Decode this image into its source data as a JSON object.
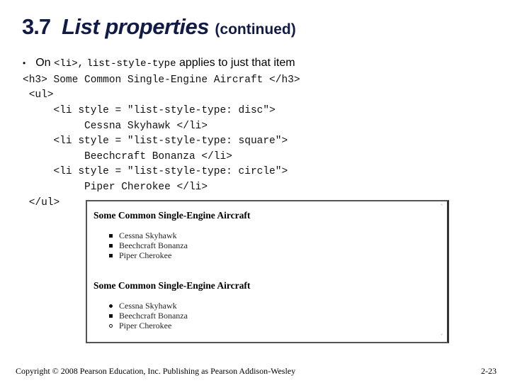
{
  "title": {
    "number": "3.7",
    "main": "List properties",
    "suffix": "(continued)"
  },
  "bullet": {
    "prefix": "On",
    "code1": "<li>,",
    "code2": "list-style-type",
    "suffix": "applies to just that item"
  },
  "code_lines": [
    "<h3> Some Common Single-Engine Aircraft </h3>",
    " <ul>",
    "     <li style = \"list-style-type: disc\">",
    "          Cessna Skyhawk </li>",
    "     <li style = \"list-style-type: square\">",
    "          Beechcraft Bonanza </li>",
    "     <li style = \"list-style-type: circle\">",
    "          Piper Cherokee </li>",
    " </ul>"
  ],
  "screenshot": {
    "lists": [
      {
        "heading": "Some Common Single-Engine Aircraft",
        "items": [
          {
            "text": "Cessna Skyhawk",
            "marker": "square"
          },
          {
            "text": "Beechcraft Bonanza",
            "marker": "square"
          },
          {
            "text": "Piper Cherokee",
            "marker": "square"
          }
        ]
      },
      {
        "heading": "Some Common Single-Engine Aircraft",
        "items": [
          {
            "text": "Cessna Skyhawk",
            "marker": "disc"
          },
          {
            "text": "Beechcraft Bonanza",
            "marker": "square"
          },
          {
            "text": "Piper Cherokee",
            "marker": "circle"
          }
        ]
      }
    ]
  },
  "footer": {
    "copyright": "Copyright © 2008 Pearson Education, Inc. Publishing as Pearson Addison-Wesley",
    "page": "2-23"
  },
  "colors": {
    "title": "#111b45"
  }
}
